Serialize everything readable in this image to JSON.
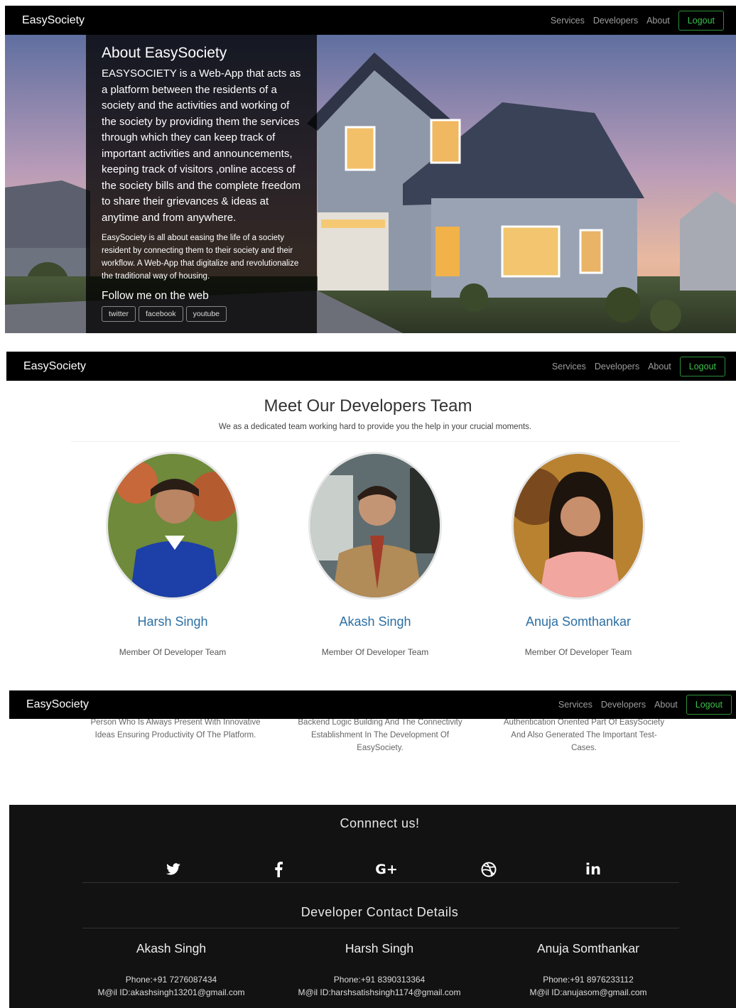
{
  "nav": {
    "brand": "EasySociety",
    "links": [
      "Services",
      "Developers",
      "About"
    ],
    "logout": "Logout"
  },
  "about": {
    "title": "About EasySociety",
    "lead": "EASYSOCIETY is a Web-App that acts as a platform between the residents of a society and the activities and working of the society by providing them the services through which they can keep track of important activities and announcements, keeping track of visitors ,online access of the society bills and the complete freedom to share their grievances & ideas at anytime and from anywhere.",
    "small": "EasySociety is all about easing the life of a society resident by connecting them to their society and their workflow. A Web-App that digitalize and revolutionalize the traditional way of housing.",
    "follow": "Follow me on the web",
    "social": [
      "twitter",
      "facebook",
      "youtube"
    ]
  },
  "developers": {
    "title": "Meet Our Developers Team",
    "subtitle": "We as a dedicated team working hard to provide you the help in your crucial moments.",
    "members": [
      {
        "name": "Harsh Singh",
        "role": "Member Of Developer Team"
      },
      {
        "name": "Akash Singh",
        "role": "Member Of Developer Team"
      },
      {
        "name": "Anuja Somthankar",
        "role": "Member Of Developer Team"
      }
    ],
    "descriptions": [
      "Person Who Is Always Present With Innovative Ideas Ensuring Productivity Of The Platform.",
      "Backend Logic Building And The Connectivity Establishment In The Development Of EasySociety.",
      "Authentication Oriented Part Of EasySociety And Also Generated The Important Test-Cases."
    ]
  },
  "footer": {
    "connect_title": "Connnect us!",
    "icons": [
      "twitter-icon",
      "facebook-icon",
      "google-plus-icon",
      "dribbble-icon",
      "linkedin-icon"
    ],
    "contact_title": "Developer Contact Details",
    "contacts": [
      {
        "name": "Akash Singh",
        "phone": "Phone:+91 7276087434",
        "email": "M@il ID:akashsingh13201@gmail.com"
      },
      {
        "name": "Harsh Singh",
        "phone": "Phone:+91 8390313364",
        "email": "M@il ID:harshsatishsingh1174@gmail.com"
      },
      {
        "name": "Anuja Somthankar",
        "phone": "Phone:+91 8976233112",
        "email": "M@il ID:anujasom@gmail.com"
      }
    ]
  }
}
